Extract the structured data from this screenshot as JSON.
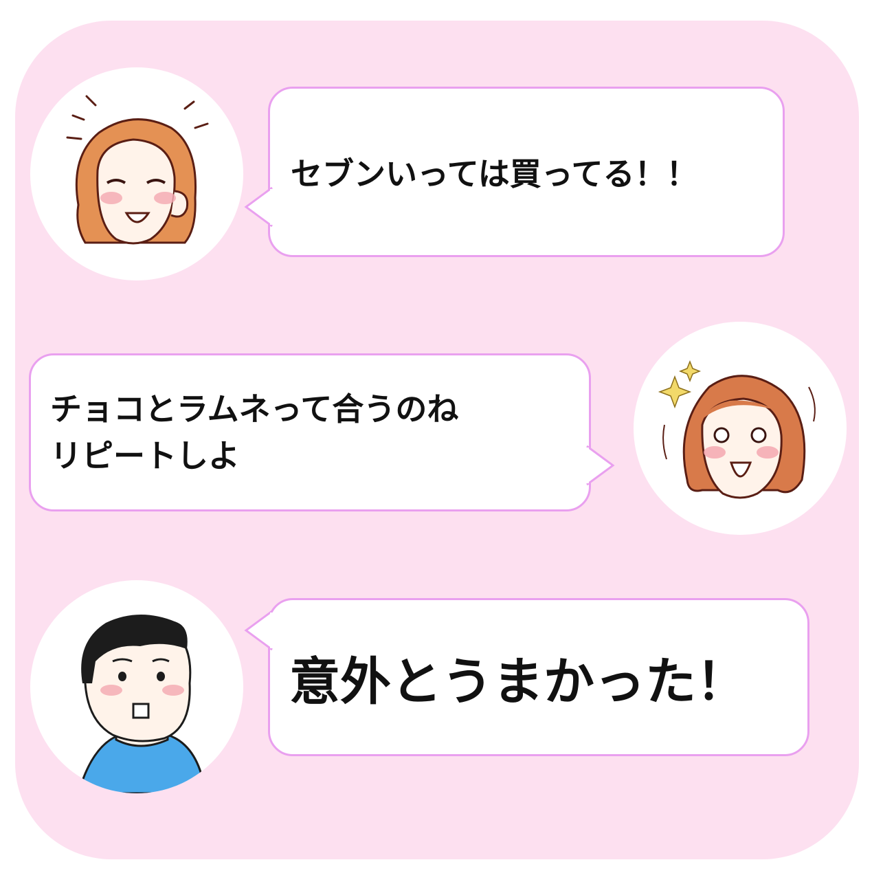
{
  "messages": [
    {
      "speaker": "woman-1",
      "side": "left",
      "text": "セブンいっては買ってる！！"
    },
    {
      "speaker": "woman-2",
      "side": "right",
      "text": "チョコとラムネって合うのね\nリピートしよ"
    },
    {
      "speaker": "man",
      "side": "left",
      "text": "意外とうまかった！"
    }
  ],
  "colors": {
    "panel_background": "#fde0f0",
    "bubble_border": "#e9a0ef",
    "bubble_fill": "#ffffff",
    "text": "#111111",
    "shirt": "#4aa8ea"
  },
  "icons": [
    "smiling-woman-avatar",
    "excited-woman-avatar",
    "man-avatar"
  ]
}
